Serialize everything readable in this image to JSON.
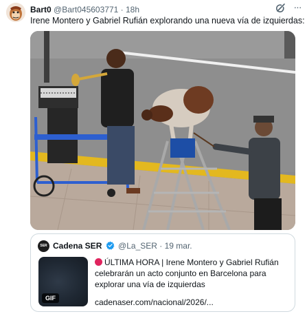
{
  "tweet": {
    "display_name": "Bart0",
    "handle": "@Bart045603771",
    "separator": "·",
    "time": "18h",
    "text": "Irene Montero y Gabriel Rufián explorando una nueva vía de izquierdas:",
    "icons": {
      "grok": "grok-icon",
      "more": "more-icon"
    }
  },
  "quote": {
    "avatar_text": "SER",
    "display_name": "Cadena SER",
    "handle": "@La_SER",
    "separator": "·",
    "date": "19 mar.",
    "gif_badge": "GIF",
    "body": "ÚLTIMA HORA | Irene Montero y Gabriel Rufián celebrarán un acto conjunto en Barcelona para explorar una vía de izquierdas",
    "link": "cadenaser.com/nacional/2026/..."
  },
  "colors": {
    "text": "#0f1419",
    "secondary": "#536471",
    "border": "#cfd9de",
    "verified": "#1d9bf0",
    "breaking_dot": "#e0245e"
  }
}
